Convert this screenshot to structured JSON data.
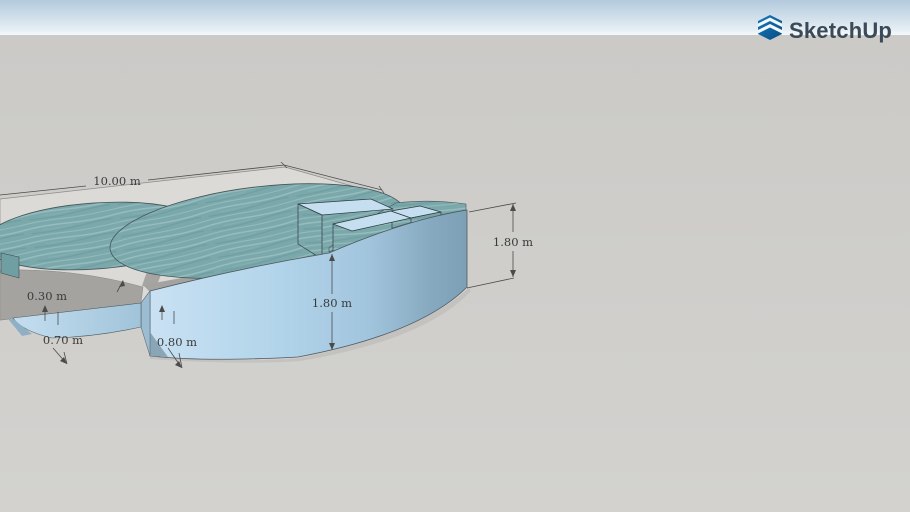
{
  "header": {
    "brand": "SketchUp"
  },
  "scene": {
    "dimensions": {
      "overall_width": "10.00 m",
      "depth_overall": "1.80 m",
      "depth_wall": "1.80 m",
      "deck_thickness": "0.30 m",
      "shallow_end": "0.70 m",
      "bench_depth": "0.80 m"
    },
    "colors": {
      "sky_top": "#b3cadd",
      "sky_bottom": "#eef3f7",
      "ground": "#cdccc9",
      "water": "#7aa8ab",
      "pool_wall": "#aecde4",
      "deck_top": "#dcdad6",
      "deck_shade": "#a5a3a0",
      "dimension_text": "#3b3b3b",
      "logo_blue": "#1074b6",
      "logo_text": "#3a4a58"
    }
  }
}
